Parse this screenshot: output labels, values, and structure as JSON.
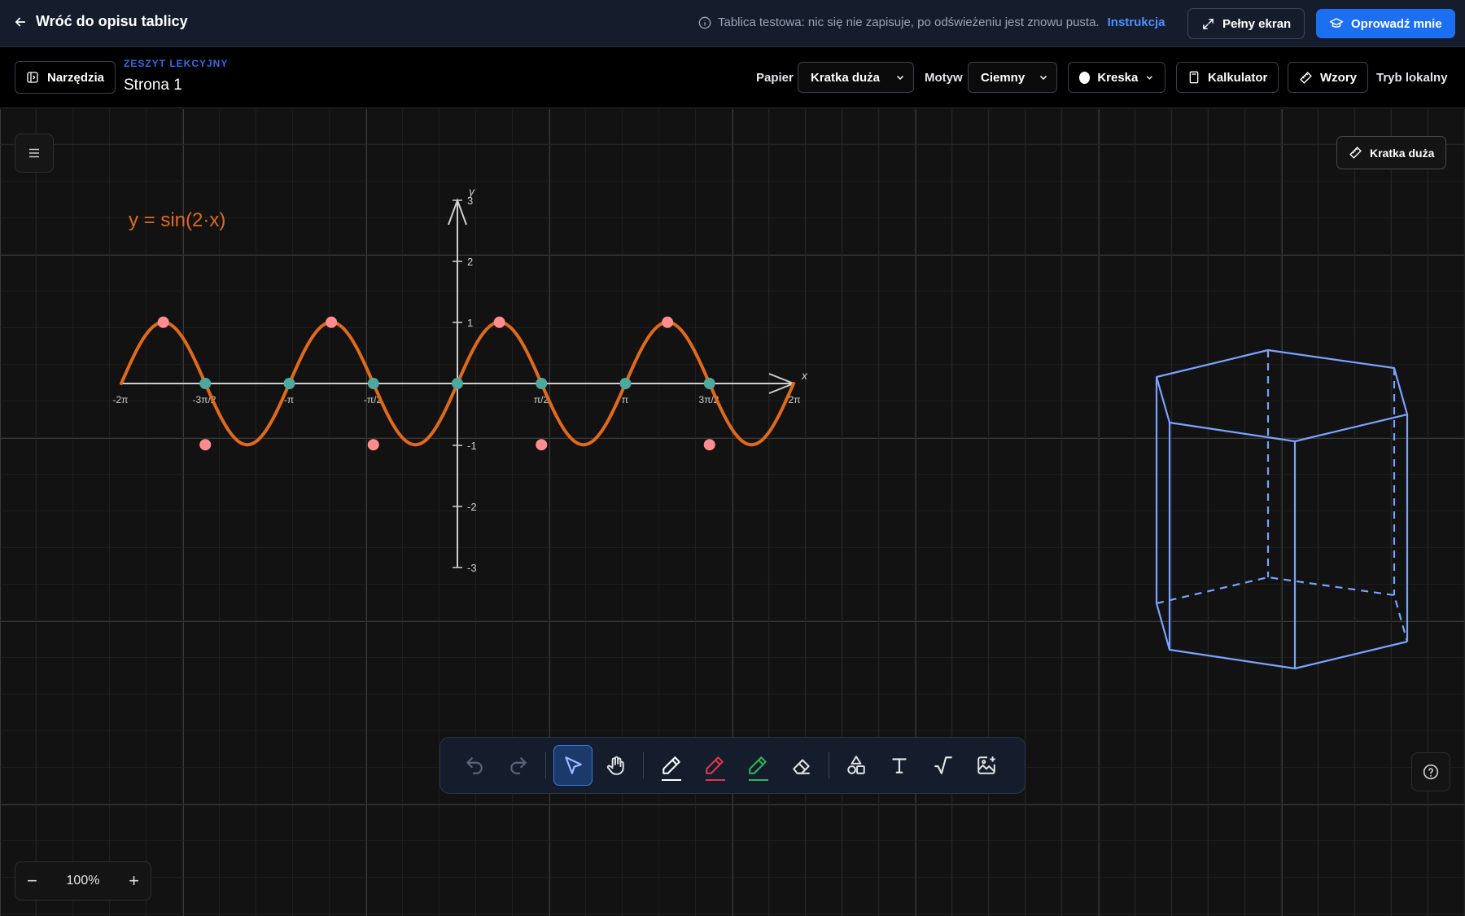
{
  "topbar": {
    "back_label": "Wróć do opisu tablicy",
    "info_text": "Tablica testowa: nic się nie zapisuje, po odświeżeniu jest znowu pusta.",
    "info_link": "Instrukcja",
    "fullscreen_label": "Pełny ekran",
    "guide_label": "Oprowadź mnie"
  },
  "secbar": {
    "tools_label": "Narzędzia",
    "notebook_label": "ZESZYT LEKCYJNY",
    "page_name": "Strona 1",
    "paper_label": "Papier",
    "paper_value": "Kratka duża",
    "theme_label": "Motyw",
    "theme_value": "Ciemny",
    "stroke_label": "Kreska",
    "calculator_label": "Kalkulator",
    "formulas_label": "Wzory",
    "local_mode_label": "Tryb lokalny"
  },
  "canvas": {
    "paper_badge": "Kratka duża",
    "formula": "y = sin(2·x)",
    "axis_x_label": "x",
    "axis_y_label": "y",
    "x_ticks": [
      "-2π",
      "-3π/2",
      "-π",
      "-π/2",
      "π/2",
      "π",
      "3π/2",
      "2π"
    ],
    "y_ticks": [
      "3",
      "2",
      "1",
      "-1",
      "-2",
      "-3"
    ],
    "function_color": "#e06a1c",
    "max_point_color": "#ff8d8d",
    "zero_point_color": "#4ea89c",
    "prism_color": "#7aa2ff"
  },
  "chart_data": {
    "type": "line",
    "title": "y = sin(2·x)",
    "xlabel": "x",
    "ylabel": "y",
    "xlim": [
      -6.2832,
      6.2832
    ],
    "ylim": [
      -3,
      3
    ],
    "function": "sin(2x)",
    "extrema": [
      {
        "x": -5.4978,
        "y": 1
      },
      {
        "x": -4.7124,
        "y": -1
      },
      {
        "x": -2.3562,
        "y": 1
      },
      {
        "x": -1.5708,
        "y": -1
      },
      {
        "x": 0.7854,
        "y": 1
      },
      {
        "x": 1.5708,
        "y": -1
      },
      {
        "x": 3.927,
        "y": 1
      },
      {
        "x": 4.7124,
        "y": -1
      }
    ],
    "zeros": [
      -4.7124,
      -3.1416,
      -1.5708,
      0,
      1.5708,
      3.1416,
      4.7124
    ]
  },
  "zoom": {
    "value": "100%",
    "minus": "−",
    "plus": "+"
  }
}
